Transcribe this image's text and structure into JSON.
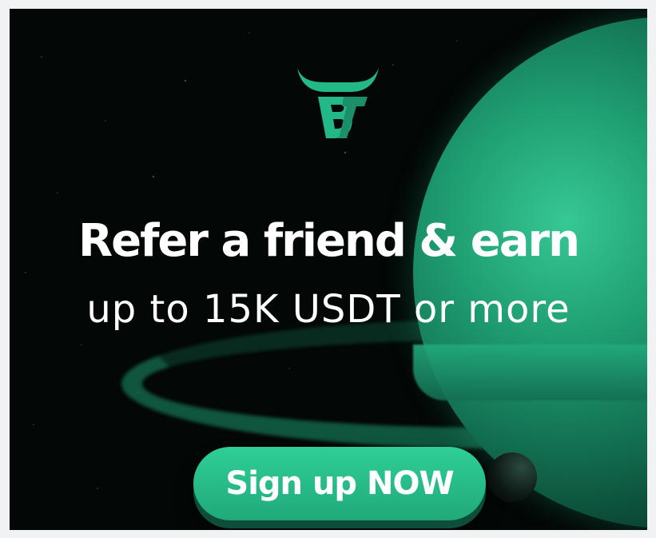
{
  "ad": {
    "headline": "Refer a friend & earn",
    "subline": "up to 15K USDT or more",
    "cta_label": "Sign up NOW"
  },
  "logo": {
    "name": "bull-logo",
    "text": "BT"
  },
  "icons": {
    "logo": "bull-horns-logo-icon"
  },
  "colors": {
    "accent": "#23b888",
    "background": "#030706",
    "text": "#ffffff"
  }
}
